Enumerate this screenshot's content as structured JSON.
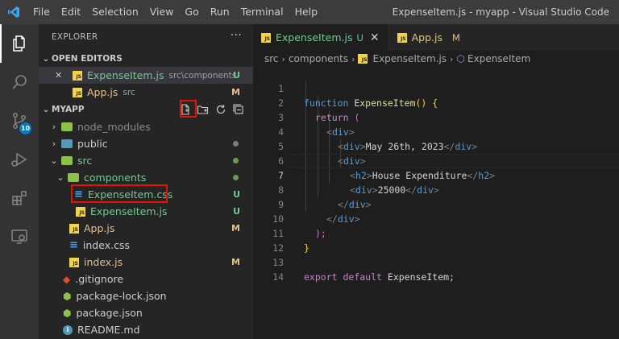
{
  "title_bar": {
    "menu": [
      "File",
      "Edit",
      "Selection",
      "View",
      "Go",
      "Run",
      "Terminal",
      "Help"
    ],
    "window_title": "ExpenseItem.js - myapp - Visual Studio Code"
  },
  "activity_bar": {
    "items": [
      "explorer-icon",
      "search-icon",
      "source-control-icon",
      "run-debug-icon",
      "extensions-icon",
      "remote-explorer-icon"
    ],
    "scm_badge": "10"
  },
  "sidebar": {
    "header": "EXPLORER",
    "more": "···",
    "open_editors": {
      "title": "OPEN EDITORS",
      "items": [
        {
          "close": "✕",
          "name": "ExpenseItem.js",
          "desc": "src\\components",
          "status": "U"
        },
        {
          "name": "App.js",
          "desc": "src",
          "status": "M"
        }
      ]
    },
    "project": {
      "title": "MYAPP",
      "tree": [
        {
          "name": "node_modules",
          "type": "folder",
          "color": "#8dc149"
        },
        {
          "name": "public",
          "type": "folder",
          "color": "#519aba"
        },
        {
          "name": "src",
          "type": "folder",
          "color": "#8dc149"
        },
        {
          "name": "components",
          "type": "folder",
          "color": "#8dc149"
        },
        {
          "name": "ExpenseItem.css",
          "type": "css",
          "status": "U"
        },
        {
          "name": "ExpenseItem.js",
          "type": "js",
          "status": "U"
        },
        {
          "name": "App.js",
          "type": "js",
          "status": "M"
        },
        {
          "name": "index.css",
          "type": "css"
        },
        {
          "name": "index.js",
          "type": "js",
          "status": "M"
        },
        {
          "name": ".gitignore",
          "type": "git"
        },
        {
          "name": "package-lock.json",
          "type": "json"
        },
        {
          "name": "package.json",
          "type": "json"
        },
        {
          "name": "README.md",
          "type": "info"
        }
      ]
    }
  },
  "editor": {
    "tabs": [
      {
        "name": "ExpenseItem.js",
        "flag": "U",
        "close": "✕"
      },
      {
        "name": "App.js",
        "flag": "M"
      }
    ],
    "breadcrumb": [
      "src",
      "components",
      "ExpenseItem.js",
      "ExpenseItem"
    ],
    "line_numbers": [
      "1",
      "2",
      "3",
      "4",
      "5",
      "6",
      "7",
      "8",
      "9",
      "10",
      "11",
      "12",
      "13",
      "14"
    ],
    "code": {
      "l1": {
        "kw": "function",
        "fn": "ExpenseItem",
        "rest": "() {"
      },
      "l2": {
        "ctl": "return",
        "rest": "("
      },
      "l3": {
        "tag": "div"
      },
      "l4": {
        "tag": "div",
        "text": "May 26th, 2023"
      },
      "l5": {
        "tag": "div"
      },
      "l6": {
        "tag": "h2",
        "text": "House Expenditure"
      },
      "l7": {
        "tag": "div",
        "text": "25000"
      },
      "l8": {
        "tag": "div"
      },
      "l9": {
        "tag": "div"
      },
      "l10": ");",
      "l11": "}",
      "l13": {
        "kw1": "export",
        "kw2": "default",
        "ident": "ExpenseItem;"
      }
    }
  },
  "colors": {
    "accent": "#007acc",
    "untracked": "#73c991",
    "modified": "#e2c08d",
    "highlight": "#e51400"
  }
}
